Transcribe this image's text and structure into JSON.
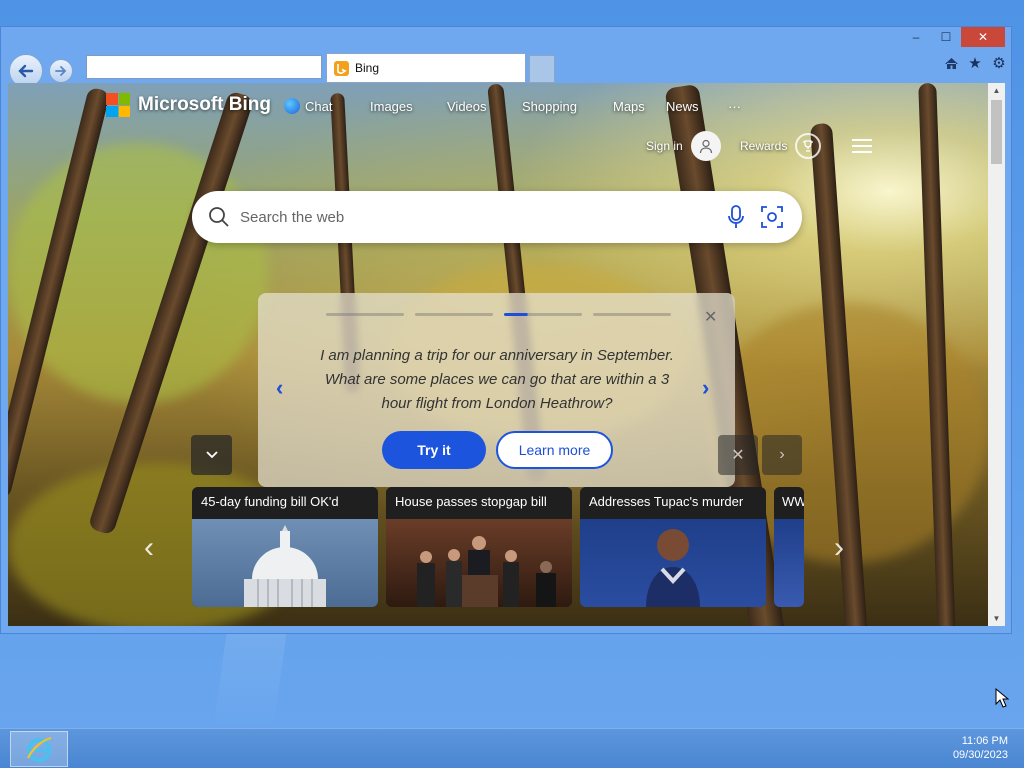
{
  "window": {
    "tab_title": "Bing",
    "controls": {
      "minimize": "‒",
      "maximize": "☐",
      "close": "✕"
    }
  },
  "bing": {
    "brand": "Microsoft Bing",
    "nav": [
      {
        "label": "Chat",
        "icon": "chat-icon"
      },
      {
        "label": "Images"
      },
      {
        "label": "Videos"
      },
      {
        "label": "Shopping"
      },
      {
        "label": "Maps"
      },
      {
        "label": "News"
      },
      {
        "label": "···"
      }
    ],
    "sign_in": "Sign in",
    "rewards": "Rewards",
    "search": {
      "placeholder": "Search the web"
    }
  },
  "prompt_card": {
    "text": "I am planning a trip for our anniversary in September. What are some places we can go that are within a 3 hour flight from London Heathrow?",
    "try_label": "Try it",
    "learn_label": "Learn more",
    "active_step": 3,
    "steps": 4
  },
  "news": [
    {
      "title": "45-day funding bill OK'd"
    },
    {
      "title": "House passes stopgap bill"
    },
    {
      "title": "Addresses Tupac's murder"
    },
    {
      "title": "WW"
    }
  ],
  "taskbar": {
    "time": "11:06 PM",
    "date": "09/30/2023"
  }
}
